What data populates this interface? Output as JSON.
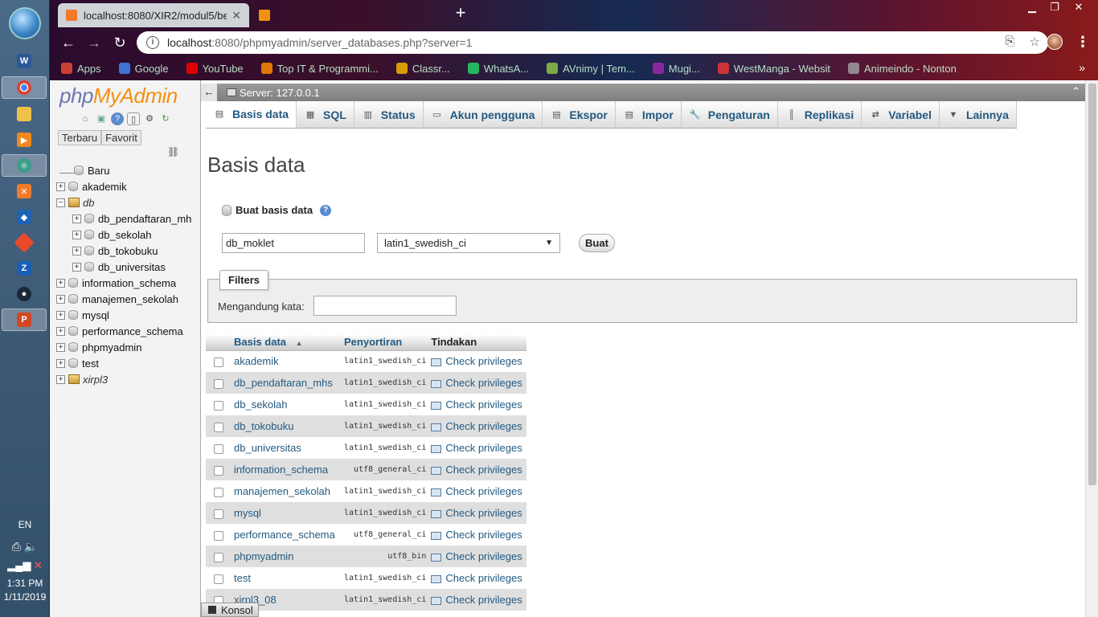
{
  "taskbar": {
    "language": "EN",
    "time": "1:31 PM",
    "date": "1/11/2019"
  },
  "browser": {
    "active_tab_title": "localhost:8080/XIR2/modul5/ber",
    "inactive_tab_title": "",
    "url_host": "localhost",
    "url_path": ":8080/phpmyadmin/server_databases.php?server=1",
    "bookmarks": [
      {
        "label": "Apps",
        "icon": "apps-grid-icon",
        "color": "#e94a35"
      },
      {
        "label": "Google",
        "icon": "google-icon",
        "color": "#4285f4"
      },
      {
        "label": "YouTube",
        "icon": "youtube-icon",
        "color": "#ff0000"
      },
      {
        "label": "Top IT & Programmi...",
        "icon": "firefox-icon",
        "color": "#ff8a00"
      },
      {
        "label": "Classr...",
        "icon": "classroom-icon",
        "color": "#f6b400"
      },
      {
        "label": "WhatsA...",
        "icon": "whatsapp-icon",
        "color": "#25d366"
      },
      {
        "label": "AVnimy | Tem...",
        "icon": "avnimy-icon",
        "color": "#8bc34a"
      },
      {
        "label": "Mugi...",
        "icon": "mugi-icon",
        "color": "#9c27b0"
      },
      {
        "label": "WestManga - Websit",
        "icon": "westmanga-icon",
        "color": "#e53935"
      },
      {
        "label": "Animeindo - Nonton",
        "icon": "animeindo-icon",
        "color": "#9e9e9e"
      }
    ]
  },
  "pma_nav": {
    "logo_php": "php",
    "logo_myadmin": "MyAdmin",
    "tab_recent": "Terbaru",
    "tab_favorites": "Favorit",
    "tree": [
      {
        "label": "Baru",
        "indent": 0,
        "type": "new"
      },
      {
        "label": "akademik",
        "indent": 0,
        "type": "db"
      },
      {
        "label": "db",
        "indent": 0,
        "type": "group-open"
      },
      {
        "label": "db_pendaftaran_mh",
        "indent": 1,
        "type": "db"
      },
      {
        "label": "db_sekolah",
        "indent": 1,
        "type": "db"
      },
      {
        "label": "db_tokobuku",
        "indent": 1,
        "type": "db"
      },
      {
        "label": "db_universitas",
        "indent": 1,
        "type": "db"
      },
      {
        "label": "information_schema",
        "indent": 0,
        "type": "db"
      },
      {
        "label": "manajemen_sekolah",
        "indent": 0,
        "type": "db"
      },
      {
        "label": "mysql",
        "indent": 0,
        "type": "db"
      },
      {
        "label": "performance_schema",
        "indent": 0,
        "type": "db"
      },
      {
        "label": "phpmyadmin",
        "indent": 0,
        "type": "db"
      },
      {
        "label": "test",
        "indent": 0,
        "type": "db"
      },
      {
        "label": "xirpl3",
        "indent": 0,
        "type": "group"
      }
    ]
  },
  "server_bar": {
    "label": "Server: 127.0.0.1"
  },
  "top_menu": [
    {
      "label": "Basis data",
      "icon": "database-icon",
      "active": true
    },
    {
      "label": "SQL",
      "icon": "sql-icon",
      "active": false
    },
    {
      "label": "Status",
      "icon": "status-icon",
      "active": false
    },
    {
      "label": "Akun pengguna",
      "icon": "users-icon",
      "active": false
    },
    {
      "label": "Ekspor",
      "icon": "export-icon",
      "active": false
    },
    {
      "label": "Impor",
      "icon": "import-icon",
      "active": false
    },
    {
      "label": "Pengaturan",
      "icon": "wrench-icon",
      "active": false
    },
    {
      "label": "Replikasi",
      "icon": "replication-icon",
      "active": false
    },
    {
      "label": "Variabel",
      "icon": "variables-icon",
      "active": false
    },
    {
      "label": "Lainnya",
      "icon": "chevron-down-icon",
      "active": false
    }
  ],
  "main": {
    "title": "Basis data",
    "create_label": "Buat basis data",
    "dbname_value": "db_moklet",
    "collation_value": "latin1_swedish_ci",
    "create_button": "Buat",
    "filters_legend": "Filters",
    "filters_label": "Mengandung kata:",
    "filters_value": ""
  },
  "table": {
    "headers": {
      "name": "Basis data",
      "sort_indicator": "▲",
      "collation": "Penyortiran",
      "action": "Tindakan"
    },
    "action_label": "Check privileges",
    "rows": [
      {
        "name": "akademik",
        "collation": "latin1_swedish_ci"
      },
      {
        "name": "db_pendaftaran_mhs",
        "collation": "latin1_swedish_ci"
      },
      {
        "name": "db_sekolah",
        "collation": "latin1_swedish_ci"
      },
      {
        "name": "db_tokobuku",
        "collation": "latin1_swedish_ci"
      },
      {
        "name": "db_universitas",
        "collation": "latin1_swedish_ci"
      },
      {
        "name": "information_schema",
        "collation": "utf8_general_ci"
      },
      {
        "name": "manajemen_sekolah",
        "collation": "latin1_swedish_ci"
      },
      {
        "name": "mysql",
        "collation": "latin1_swedish_ci"
      },
      {
        "name": "performance_schema",
        "collation": "utf8_general_ci"
      },
      {
        "name": "phpmyadmin",
        "collation": "utf8_bin"
      },
      {
        "name": "test",
        "collation": "latin1_swedish_ci"
      },
      {
        "name": "xirpl3_08",
        "collation": "latin1_swedish_ci"
      }
    ]
  },
  "console_label": "Konsol",
  "colors": {
    "link": "#235a81",
    "logo_php": "#6c78af",
    "logo_myadmin": "#f29111"
  }
}
